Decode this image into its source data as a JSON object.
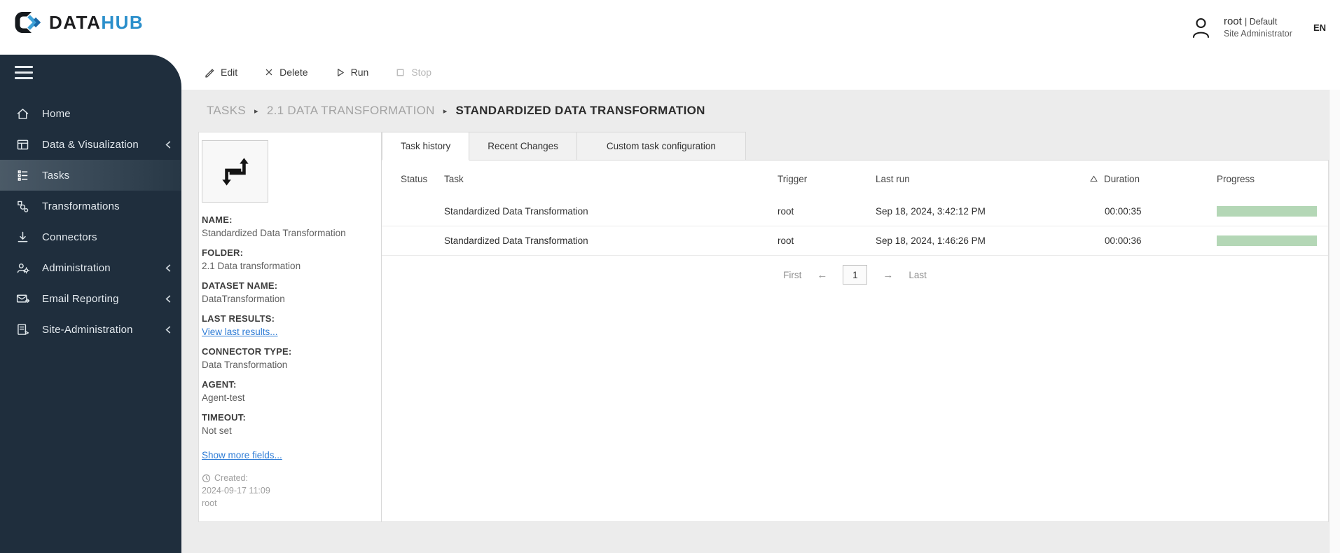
{
  "header": {
    "logo_prefix": "DATA",
    "logo_suffix": "HUB",
    "user_name": "root",
    "user_suffix": "| Default",
    "user_role": "Site Administrator",
    "lang": "EN"
  },
  "sidebar": {
    "items": [
      {
        "label": "Home",
        "icon": "home-icon",
        "active": false,
        "collapsible": false
      },
      {
        "label": "Data & Visualization",
        "icon": "data-visualization-icon",
        "active": false,
        "collapsible": true
      },
      {
        "label": "Tasks",
        "icon": "tasks-icon",
        "active": true,
        "collapsible": false
      },
      {
        "label": "Transformations",
        "icon": "transformations-icon",
        "active": false,
        "collapsible": false
      },
      {
        "label": "Connectors",
        "icon": "connectors-icon",
        "active": false,
        "collapsible": false
      },
      {
        "label": "Administration",
        "icon": "administration-icon",
        "active": false,
        "collapsible": true
      },
      {
        "label": "Email Reporting",
        "icon": "email-reporting-icon",
        "active": false,
        "collapsible": true
      },
      {
        "label": "Site-Administration",
        "icon": "site-administration-icon",
        "active": false,
        "collapsible": true
      }
    ]
  },
  "toolbar": {
    "buttons": [
      {
        "label": "Edit",
        "icon": "edit-icon",
        "disabled": false
      },
      {
        "label": "Delete",
        "icon": "delete-icon",
        "disabled": false
      },
      {
        "label": "Run",
        "icon": "run-icon",
        "disabled": false
      },
      {
        "label": "Stop",
        "icon": "stop-icon",
        "disabled": true
      }
    ]
  },
  "breadcrumb": {
    "separator": "▸",
    "items": [
      "TASKS",
      "2.1 DATA TRANSFORMATION",
      "STANDARDIZED DATA TRANSFORMATION"
    ]
  },
  "details": {
    "fields": [
      {
        "label": "NAME:",
        "value": "Standardized Data Transformation",
        "link": false
      },
      {
        "label": "FOLDER:",
        "value": "2.1 Data transformation",
        "link": false
      },
      {
        "label": "DATASET NAME:",
        "value": "DataTransformation",
        "link": false
      },
      {
        "label": "LAST RESULTS:",
        "value": "View last results...",
        "link": true
      },
      {
        "label": "CONNECTOR TYPE:",
        "value": "Data Transformation",
        "link": false
      },
      {
        "label": "AGENT:",
        "value": "Agent-test",
        "link": false
      },
      {
        "label": "TIMEOUT:",
        "value": "Not set",
        "link": false
      }
    ],
    "show_more": "Show more fields...",
    "created_label": "Created:",
    "created_date": "2024-09-17 11:09",
    "created_by": "root"
  },
  "tabs": [
    {
      "label": "Task history",
      "active": true
    },
    {
      "label": "Recent Changes",
      "active": false
    },
    {
      "label": "Custom task configuration",
      "active": false
    }
  ],
  "table": {
    "columns": [
      "Status",
      "Task",
      "Trigger",
      "Last run",
      "Duration",
      "Progress"
    ],
    "rows": [
      {
        "status": "success",
        "task": "Standardized Data Transformation",
        "trigger": "root",
        "last_run": "Sep 18, 2024, 3:42:12 PM",
        "duration": "00:00:35",
        "progress_percent": 100
      },
      {
        "status": "success",
        "task": "Standardized Data Transformation",
        "trigger": "root",
        "last_run": "Sep 18, 2024, 1:46:26 PM",
        "duration": "00:00:36",
        "progress_percent": 100
      }
    ],
    "sort": {
      "column": "Duration",
      "direction": "ascending"
    }
  },
  "pagination": {
    "first": "First",
    "prev": "←",
    "page": "1",
    "next": "→",
    "last": "Last"
  },
  "colors": {
    "accent_blue": "#2b8fcb",
    "link_blue": "#2e7cd6",
    "status_green": "#2e9150",
    "progress_green": "#b4d7b6",
    "sidebar_bg": "#1f2e3d",
    "page_bg": "#ececec"
  }
}
